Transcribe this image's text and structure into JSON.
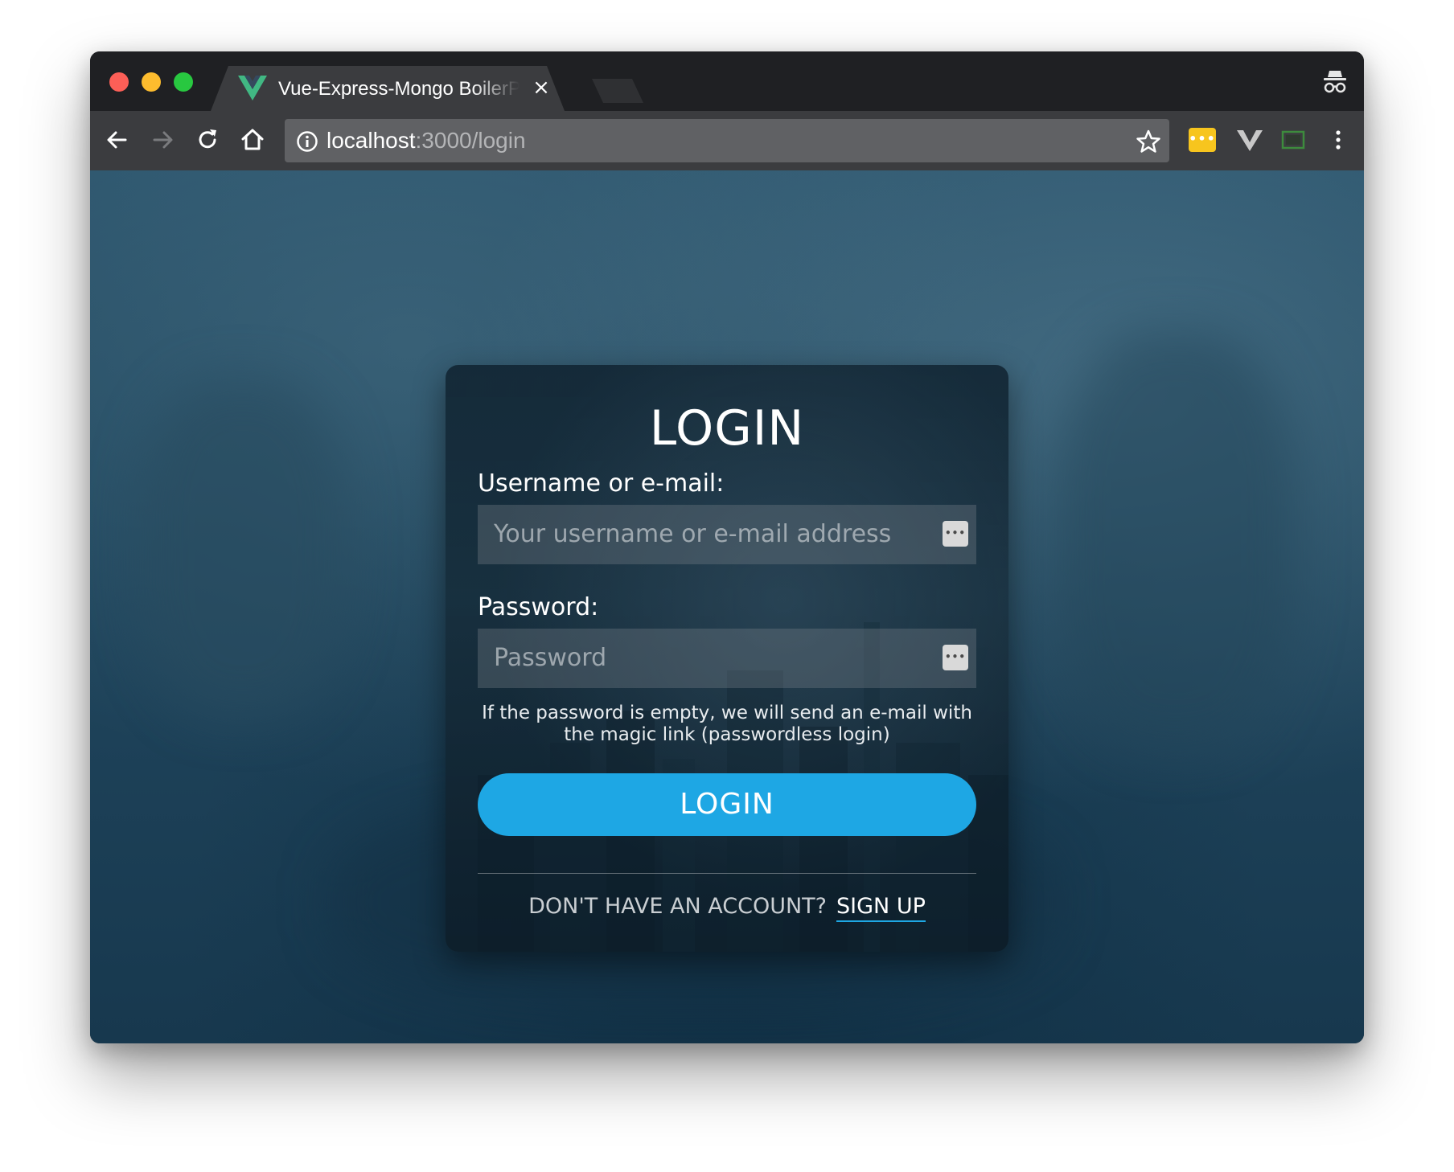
{
  "browser": {
    "tab": {
      "title": "Vue-Express-Mongo BoilerPlate",
      "close_glyph": "×"
    },
    "address": {
      "host": "localhost",
      "port_path": ":3000/login"
    },
    "extensions": {
      "password_manager_glyph": "•••"
    }
  },
  "login": {
    "title": "LOGIN",
    "username_label": "Username or e-mail:",
    "username_placeholder": "Your username or e-mail address",
    "password_label": "Password:",
    "password_placeholder": "Password",
    "field_key_glyph": "•••",
    "hint": "If the password is empty, we will send an e-mail with the magic link (passwordless login)",
    "submit_label": "LOGIN",
    "no_account_text": "DON'T HAVE AN ACCOUNT?",
    "signup_label": "SIGN UP"
  },
  "colors": {
    "accent": "#1ea7e4",
    "vue_green": "#41b883",
    "close_red": "#fc5f57",
    "minimize_yellow": "#fdbc2e",
    "zoom_green": "#28c840",
    "extension_yellow": "#f7c51e"
  },
  "icons": [
    "back-icon",
    "forward-icon",
    "reload-icon",
    "home-icon",
    "info-icon",
    "star-icon",
    "vue-devtools-icon",
    "screen-capture-icon",
    "menu-icon",
    "incognito-icon"
  ]
}
